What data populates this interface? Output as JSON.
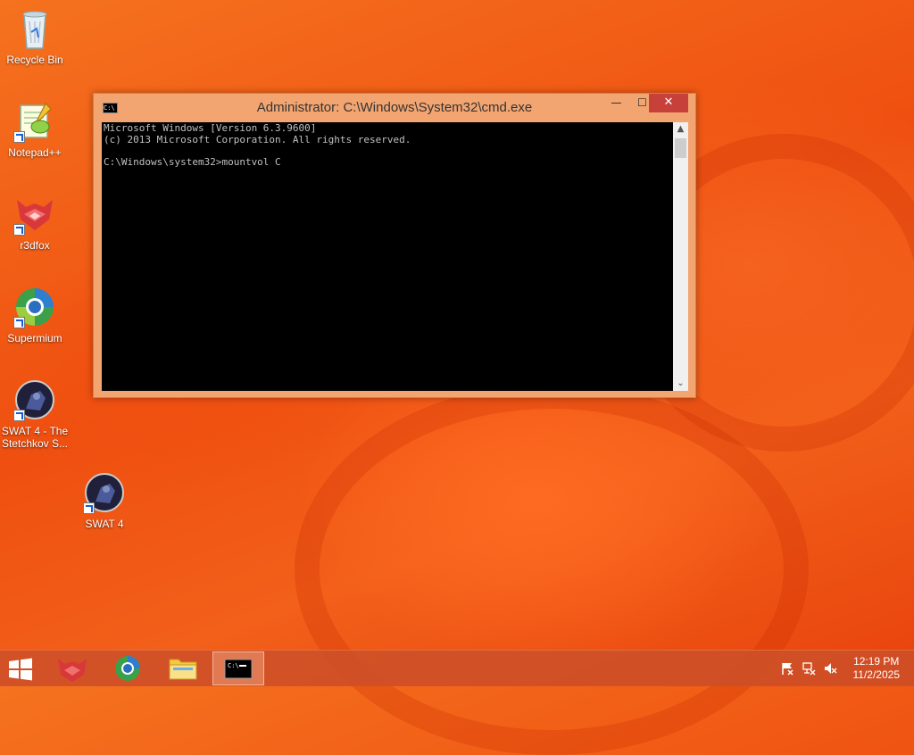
{
  "desktop": {
    "icons": [
      {
        "label": "Recycle Bin",
        "icon": "recycle-bin-icon"
      },
      {
        "label": "Notepad++",
        "icon": "notepad-plus-plus-icon"
      },
      {
        "label": "r3dfox",
        "icon": "r3dfox-icon"
      },
      {
        "label": "Supermium",
        "icon": "supermium-icon"
      },
      {
        "label": "SWAT 4 - The Stetchkov S...",
        "icon": "swat4-stetchkov-icon"
      },
      {
        "label": "SWAT 4",
        "icon": "swat4-icon"
      }
    ]
  },
  "window": {
    "title": "Administrator: C:\\Windows\\System32\\cmd.exe",
    "title_icon_text": "C:\\",
    "minimize_glyph": "—",
    "maximize_glyph": "☐",
    "close_glyph": "✕",
    "console_lines": [
      "Microsoft Windows [Version 6.3.9600]",
      "(c) 2013 Microsoft Corporation. All rights reserved.",
      "",
      "C:\\Windows\\system32>mountvol C"
    ]
  },
  "taskbar": {
    "apps": [
      {
        "icon": "r3dfox-icon",
        "active": false
      },
      {
        "icon": "supermium-icon",
        "active": false
      },
      {
        "icon": "file-explorer-icon",
        "active": false
      },
      {
        "icon": "command-prompt-icon",
        "active": true
      }
    ],
    "tray": [
      "action-center-flag-icon",
      "network-icon",
      "volume-muted-icon"
    ],
    "clock": {
      "time": "12:19 PM",
      "date": "11/2/2025"
    }
  },
  "colors": {
    "accent": "#f3a571",
    "close": "#c7403a",
    "taskbar": "#cd5028"
  }
}
